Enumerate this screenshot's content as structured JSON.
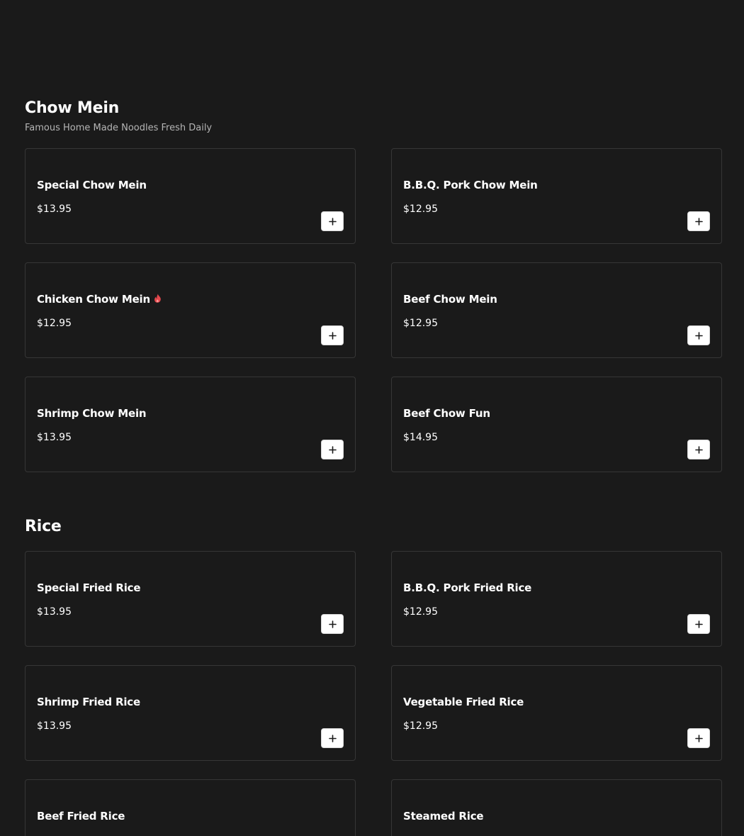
{
  "sections": [
    {
      "title": "Chow Mein",
      "subtitle": "Famous Home Made Noodles Fresh Daily",
      "items": [
        {
          "name": "Special Chow Mein",
          "price": "$13.95",
          "spicy": false
        },
        {
          "name": "B.B.Q. Pork Chow Mein",
          "price": "$12.95",
          "spicy": false
        },
        {
          "name": "Chicken Chow Mein",
          "price": "$12.95",
          "spicy": true
        },
        {
          "name": "Beef Chow Mein",
          "price": "$12.95",
          "spicy": false
        },
        {
          "name": "Shrimp Chow Mein",
          "price": "$13.95",
          "spicy": false
        },
        {
          "name": "Beef Chow Fun",
          "price": "$14.95",
          "spicy": false
        }
      ]
    },
    {
      "title": "Rice",
      "subtitle": "",
      "items": [
        {
          "name": "Special Fried Rice",
          "price": "$13.95",
          "spicy": false
        },
        {
          "name": "B.B.Q. Pork Fried Rice",
          "price": "$12.95",
          "spicy": false
        },
        {
          "name": "Shrimp Fried Rice",
          "price": "$13.95",
          "spicy": false
        },
        {
          "name": "Vegetable Fried Rice",
          "price": "$12.95",
          "spicy": false
        },
        {
          "name": "Beef Fried Rice",
          "price": "",
          "spicy": false
        },
        {
          "name": "Steamed Rice",
          "price": "",
          "spicy": false
        }
      ]
    }
  ],
  "colors": {
    "background": "#1a1a1a",
    "card_border": "#363636",
    "spicy_icon": "#e5484d",
    "add_button": "#ffffff"
  },
  "icons": {
    "add": "plus-icon",
    "spicy": "flame-icon"
  }
}
